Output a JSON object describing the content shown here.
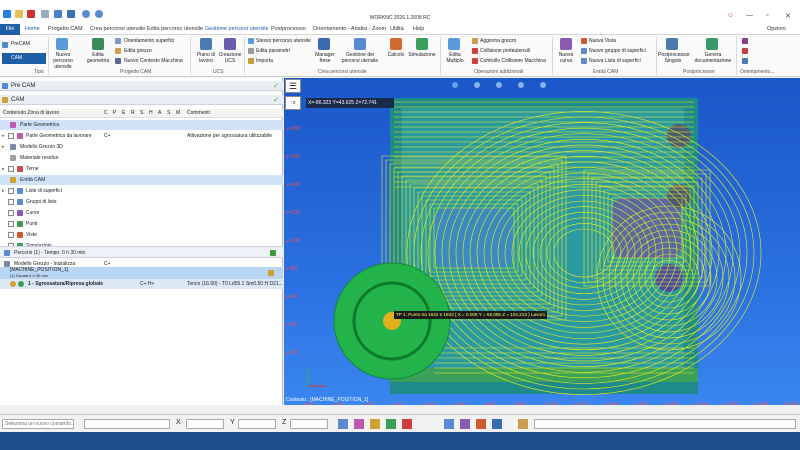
{
  "window": {
    "title": "WORKNC 2026.1.2608 RC",
    "options_label": "Opzioni"
  },
  "tabs": [
    {
      "label": "File"
    },
    {
      "label": "Home"
    },
    {
      "label": "Progetto CAM"
    },
    {
      "label": "Crea percorso utensile"
    },
    {
      "label": "Edita percorso utensile"
    },
    {
      "label": "Gestione percorsi utensile"
    },
    {
      "label": "Postprocessor"
    },
    {
      "label": "Orientamento - Analisi - Zoom"
    },
    {
      "label": "Utilità"
    },
    {
      "label": "Help"
    }
  ],
  "ribbon": {
    "mode_precam": "PreCAM",
    "mode_cam": "CAM",
    "group_tipo": "Tipo",
    "nuovo_percorso": "Nuovo percorso utensile",
    "edita_geometria": "Edita geometria",
    "orientamento_superfici": "Orientamento superfici",
    "edita_grezzo": "Edita grezzo",
    "nuovo_contesto": "Nuovo Contesto Macchina",
    "group_progetto": "Progetto CAM",
    "piano_lavoro": "Piano di lavoro",
    "creazione_ucs": "Creazione UCS",
    "group_ucs": "UCS",
    "stesso_percorso": "Stesso percorso utensile",
    "edita_parametri": "Edita parametri",
    "importa": "Importa",
    "manager_frese": "Manager frese",
    "gestione_percorsi": "Gestione dei percorsi utensile",
    "calcolo": "Calcolo",
    "simulazione": "Simulazione",
    "group_crea": "Crea percorsi utensile",
    "edita_multiplo": "Edita Multiplo",
    "aggiorna_grezzo": "Aggiorna grezzo",
    "collisione_portautensili": "Collisione portautensili",
    "controllo_collisione": "Controllo Collisione Macchina",
    "group_operazioni": "Operazioni addizionali",
    "nuova_curva": "Nuova curva",
    "nuova_vista": "Nuova Vista",
    "nuovo_gruppo": "Nuovo gruppo di superfici",
    "nuova_lista": "Nuova Lista di superfici",
    "group_entita": "Entità CAM",
    "post_singolo": "Postprocessor Singolo",
    "genera_doc": "Genera documentazione",
    "group_post": "Postprocessor",
    "group_orient": "Orientamento..."
  },
  "left_panel": {
    "precam_header": "Pre CAM",
    "cam_header": "CAM",
    "columns": [
      "Contenuto Zona di lavoro",
      "C",
      "P",
      "E",
      "R",
      "S",
      "H",
      "A",
      "S",
      "M",
      "Commenti"
    ],
    "rows": [
      {
        "label": "Parte Geometrica",
        "extra": "",
        "comment": ""
      },
      {
        "label": "Parte Geometrica da lavorare",
        "extra": "C+",
        "comment": "Attivazione per sgrossatura utilizzabile"
      },
      {
        "label": "Modello Grezzo 3D",
        "extra": "",
        "comment": ""
      },
      {
        "label": "Materiale residuo",
        "extra": "",
        "comment": ""
      },
      {
        "label": "Terne",
        "extra": "",
        "comment": ""
      },
      {
        "label": "Entità CAM",
        "extra": "",
        "comment": ""
      },
      {
        "label": "Liste di superfici",
        "extra": "",
        "comment": ""
      },
      {
        "label": "Gruppi di liste",
        "extra": "",
        "comment": ""
      },
      {
        "label": "Curve",
        "extra": "",
        "comment": ""
      },
      {
        "label": "Punti",
        "extra": "",
        "comment": ""
      },
      {
        "label": "Viste",
        "extra": "",
        "comment": ""
      },
      {
        "label": "Simulazioni",
        "extra": "",
        "comment": ""
      }
    ],
    "percorsi_summary": "Percorsi (1) - Tempo: 0 h 30 min",
    "modello_grezzo": "Modello Grezzo - Inizializza",
    "modello_grezzo_extra": "C+",
    "machine_position": "[MACHINE_POSITION_1]",
    "machine_duration": "(1) Durata 0 h 30 min",
    "toolpath_label": "1 - Sgrossatura/Ripresa globale",
    "toolpath_flags": "C+  H+",
    "toolpath_tool": "Tonco (16.00) - T0 Ld55.1 Sm0.50 H D21..."
  },
  "viewport": {
    "coord_x": "X=-86.323",
    "coord_y": "Y=43.625",
    "coord_z": "Z=72.741",
    "tooltip": "TP 1: Punto tra 1632 e 1633 ( X = 0.005  Y = 55.095  Z = 104.213 ) Lavoro",
    "context_label": "Contesto : [MACHINE_POSITION_1]",
    "y_labels": [
      "y+180",
      "y+160",
      "y+140",
      "y+120",
      "y+100",
      "y+80",
      "y+60",
      "y+40",
      "y+20"
    ],
    "x_labels": [
      "x-60",
      "x-40",
      "x-20",
      "x+0",
      "x+20",
      "x+40",
      "x+60",
      "x+80",
      "x+100",
      "x+120",
      "x+140",
      "x+160",
      "x+180",
      "x+200",
      "x+220",
      "x+240",
      "x+260"
    ]
  },
  "statusbar": {
    "command_placeholder": "Seleziona un nuovo comando...",
    "x_label": "X",
    "y_label": "Y",
    "z_label": "Z"
  },
  "colors": {
    "accent": "#1f5fa8",
    "toolpath": "#e8f020",
    "tool_green": "#22b44a",
    "viewport_bg": "#2a6fe0"
  }
}
